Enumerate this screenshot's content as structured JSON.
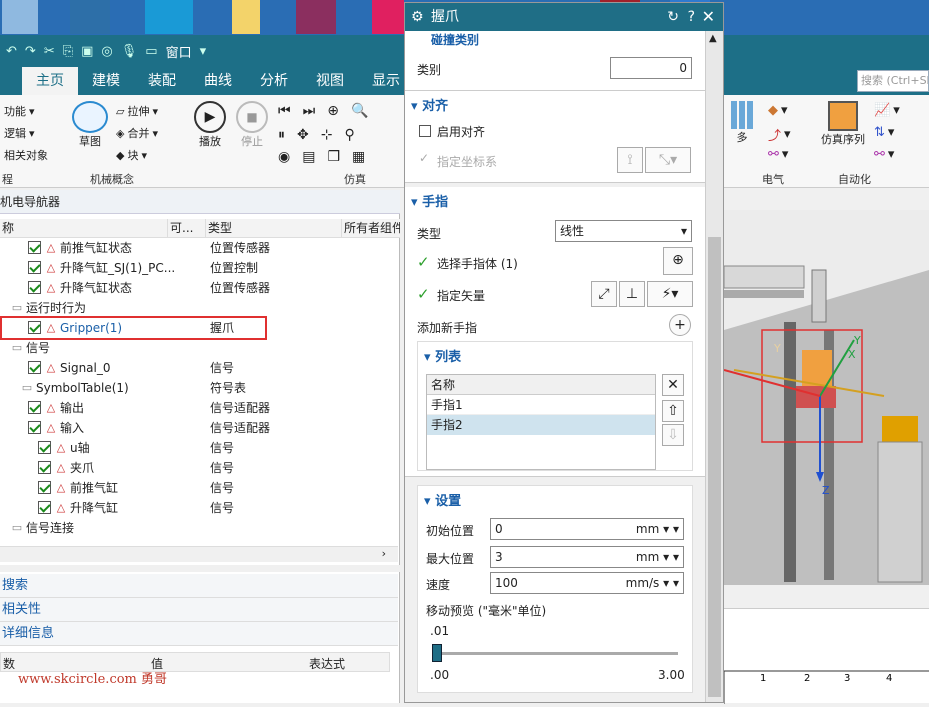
{
  "qa_bar": {
    "window_menu": "窗口"
  },
  "tabs": [
    "主页",
    "建模",
    "装配",
    "曲线",
    "分析",
    "视图",
    "显示"
  ],
  "search_placeholder": "搜索 (Ctrl+Sh",
  "ribbon": {
    "left_items": [
      "功能",
      "逻辑",
      "相关对象"
    ],
    "left_group": "程",
    "sketch": "草图",
    "mech_items": [
      "拉伸",
      "合并",
      "块"
    ],
    "mech_group": "机械概念",
    "play": "播放",
    "stop": "停止",
    "sim_group": "仿真",
    "more": "多",
    "electric_group": "电气",
    "sim_seq": "仿真序列",
    "auto_group": "自动化"
  },
  "navigator": {
    "title": "机电导航器",
    "columns": [
      "称",
      "可...",
      "类型",
      "所有者组件"
    ],
    "rows": [
      {
        "name": "前推气缸状态",
        "type": "位置传感器",
        "check": true,
        "indent": 1
      },
      {
        "name": "升降气缸_SJ(1)_PC...",
        "type": "位置控制",
        "check": true,
        "indent": 1
      },
      {
        "name": "升降气缸状态",
        "type": "位置传感器",
        "check": true,
        "indent": 1
      },
      {
        "name": "运行时行为",
        "type": "",
        "check": false,
        "indent": 0
      },
      {
        "name": "Gripper(1)",
        "type": "握爪",
        "check": true,
        "indent": 1,
        "link": true
      },
      {
        "name": "信号",
        "type": "",
        "check": false,
        "indent": 0
      },
      {
        "name": "Signal_0",
        "type": "信号",
        "check": true,
        "indent": 1
      },
      {
        "name": "SymbolTable(1)",
        "type": "符号表",
        "check": false,
        "indent": 1
      },
      {
        "name": "输出",
        "type": "信号适配器",
        "check": true,
        "indent": 1
      },
      {
        "name": "输入",
        "type": "信号适配器",
        "check": true,
        "indent": 1
      },
      {
        "name": "u轴",
        "type": "信号",
        "check": true,
        "indent": 2
      },
      {
        "name": "夹爪",
        "type": "信号",
        "check": true,
        "indent": 2
      },
      {
        "name": "前推气缸",
        "type": "信号",
        "check": true,
        "indent": 2
      },
      {
        "name": "升降气缸",
        "type": "信号",
        "check": true,
        "indent": 2
      },
      {
        "name": "信号连接",
        "type": "",
        "check": false,
        "indent": 0
      }
    ]
  },
  "bottom": {
    "panels": [
      "搜索",
      "相关性",
      "详细信息"
    ],
    "cols": [
      "数",
      "值",
      "表达式"
    ]
  },
  "dialog": {
    "title": "握爪",
    "cut_header": "碰撞类别",
    "category_label": "类别",
    "category_value": "0",
    "align": {
      "header": "对齐",
      "enable": "启用对齐",
      "csys": "指定坐标系"
    },
    "finger": {
      "header": "手指",
      "type_label": "类型",
      "type_value": "线性",
      "select_body": "选择手指体 (1)",
      "vector": "指定矢量",
      "add": "添加新手指"
    },
    "list": {
      "header": "列表",
      "col": "名称",
      "items": [
        "手指1",
        "手指2"
      ]
    },
    "settings": {
      "header": "设置",
      "init_label": "初始位置",
      "init_value": "0",
      "init_unit": "mm",
      "max_label": "最大位置",
      "max_value": "3",
      "max_unit": "mm",
      "speed_label": "速度",
      "speed_value": "100",
      "speed_unit": "mm/s",
      "preview": "移动预览 (\"毫米\"单位)",
      "slider_value": ".01",
      "slider_min": ".00",
      "slider_max": "3.00",
      "slider_fraction": 0.003
    }
  },
  "viewport": {
    "axis_y": "Y",
    "axis_z": "Z",
    "axis_y2": "Y",
    "axis_x": "X",
    "ruler": [
      "1",
      "2",
      "3",
      "4"
    ]
  },
  "watermark": "www.skcircle.com 勇哥",
  "colors": {
    "title_bar": "#1f6e86",
    "link": "#1a5fa8",
    "highlight": "#e03030",
    "check": "#1a8a1a"
  }
}
